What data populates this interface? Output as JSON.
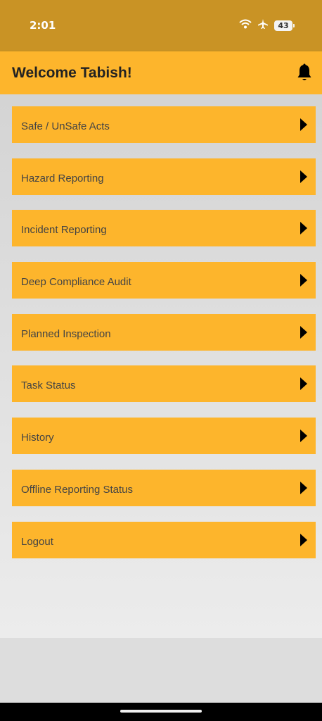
{
  "status_bar": {
    "time": "2:01",
    "battery": "43",
    "icons": [
      "wifi-icon",
      "airplane-icon",
      "battery-icon"
    ]
  },
  "header": {
    "title": "Welcome Tabish!",
    "icon": "bell-icon"
  },
  "menu": {
    "items": [
      {
        "label": "Safe / UnSafe Acts"
      },
      {
        "label": "Hazard Reporting"
      },
      {
        "label": "Incident Reporting"
      },
      {
        "label": "Deep Compliance Audit"
      },
      {
        "label": "Planned Inspection"
      },
      {
        "label": "Task Status"
      },
      {
        "label": "History"
      },
      {
        "label": "Offline Reporting Status"
      },
      {
        "label": "Logout"
      }
    ]
  },
  "colors": {
    "status_bar": "#c99325",
    "accent": "#fdb52c",
    "text_dark": "#222222",
    "label_text": "#444444"
  }
}
